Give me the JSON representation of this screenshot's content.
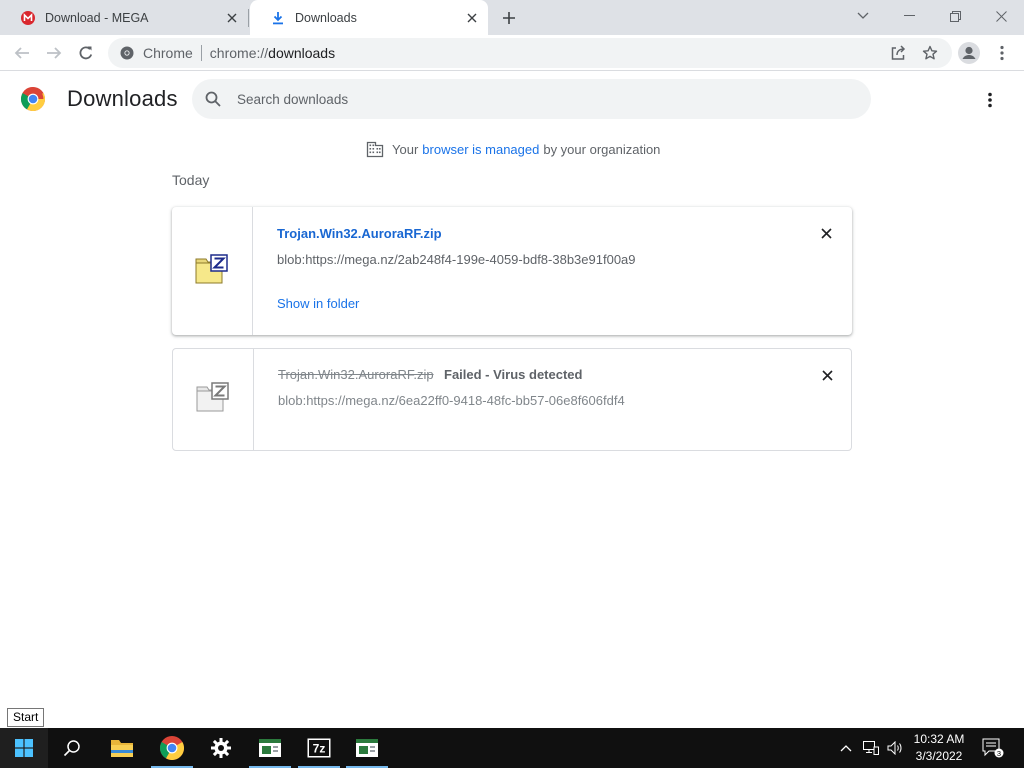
{
  "tabs": [
    {
      "title": "Download - MEGA",
      "favicon": "mega-icon"
    },
    {
      "title": "Downloads",
      "favicon": "download-icon"
    }
  ],
  "omnibox": {
    "chip": "Chrome",
    "url_scheme": "chrome://",
    "url_path": "downloads"
  },
  "page": {
    "title": "Downloads",
    "search_placeholder": "Search downloads",
    "managed_prefix": "Your",
    "managed_link": "browser is managed",
    "managed_suffix": "by your organization",
    "section": "Today"
  },
  "downloads": [
    {
      "name": "Trojan.Win32.AuroraRF.zip",
      "url": "blob:https://mega.nz/2ab248f4-199e-4059-bdf8-38b3e91f00a9",
      "action": "Show in folder",
      "icon": "zip-file-icon"
    },
    {
      "name": "Trojan.Win32.AuroraRF.zip",
      "status": "Failed - Virus detected",
      "url": "blob:https://mega.nz/6ea22ff0-9418-48fc-bb57-06e8f606fdf4",
      "icon": "zip-file-grey-icon"
    }
  ],
  "tooltip": "Start",
  "taskbar": {
    "items": [
      "start-icon",
      "search-icon",
      "file-explorer-icon",
      "chrome-icon",
      "settings-icon",
      "app-icon",
      "7zip-icon",
      "app-icon"
    ],
    "clock_time": "10:32 AM",
    "clock_date": "3/3/2022",
    "notification_count": "3"
  },
  "colors": {
    "accent": "#1a73e8",
    "link": "#1967d2",
    "taskbar": "#101010"
  }
}
